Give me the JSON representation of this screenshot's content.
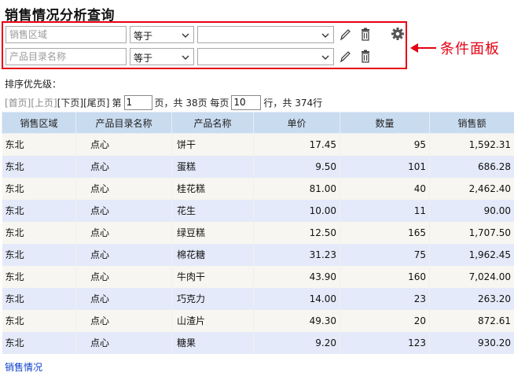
{
  "title": "销售情况分析查询",
  "condition_panel": {
    "rows": [
      {
        "field_placeholder": "销售区域",
        "operator": "等于",
        "value": ""
      },
      {
        "field_placeholder": "产品目录名称",
        "operator": "等于",
        "value": ""
      }
    ],
    "callout_label": "条件面板",
    "accent_color": "#e60012"
  },
  "sort_priority_label": "排序优先级：",
  "pager": {
    "first": "[首页]",
    "prev": "[上页]",
    "next": "[下页]",
    "last": "[尾页]",
    "page_prefix": "第",
    "current_page": "1",
    "page_suffix": "页，共 38页 每页",
    "page_size": "10",
    "rows_suffix": "行，共 374行"
  },
  "table": {
    "header_color": "#c9dbef",
    "columns": [
      "销售区域",
      "产品目录名称",
      "产品名称",
      "单价",
      "数量",
      "销售额"
    ],
    "rows": [
      [
        "东北",
        "点心",
        "饼干",
        "17.45",
        "95",
        "1,592.31"
      ],
      [
        "东北",
        "点心",
        "蛋糕",
        "9.50",
        "101",
        "686.28"
      ],
      [
        "东北",
        "点心",
        "桂花糕",
        "81.00",
        "40",
        "2,462.40"
      ],
      [
        "东北",
        "点心",
        "花生",
        "10.00",
        "11",
        "90.00"
      ],
      [
        "东北",
        "点心",
        "绿豆糕",
        "12.50",
        "165",
        "1,707.50"
      ],
      [
        "东北",
        "点心",
        "棉花糖",
        "31.23",
        "75",
        "1,962.45"
      ],
      [
        "东北",
        "点心",
        "牛肉干",
        "43.90",
        "160",
        "7,024.00"
      ],
      [
        "东北",
        "点心",
        "巧克力",
        "14.00",
        "23",
        "263.20"
      ],
      [
        "东北",
        "点心",
        "山渣片",
        "49.30",
        "20",
        "872.61"
      ],
      [
        "东北",
        "点心",
        "糖果",
        "9.20",
        "123",
        "930.20"
      ]
    ]
  },
  "footer_link": "销售情况",
  "icons": [
    "pencil-icon",
    "trash-icon",
    "gear-icon",
    "chevron-down-icon",
    "arrow-left-icon"
  ]
}
